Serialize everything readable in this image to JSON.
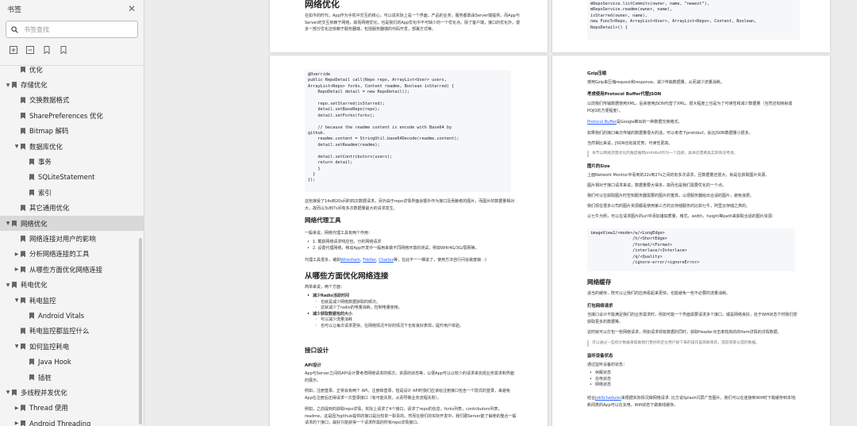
{
  "sidebar": {
    "title": "书签",
    "search_placeholder": "书签查找",
    "toc": [
      {
        "label": "优化",
        "level": 1,
        "toggle": "",
        "selected": false
      },
      {
        "label": "存储优化",
        "level": 0,
        "toggle": "▲",
        "selected": false
      },
      {
        "label": "交换数据格式",
        "level": 1,
        "toggle": "",
        "selected": false
      },
      {
        "label": "SharePreferences 优化",
        "level": 1,
        "toggle": "",
        "selected": false
      },
      {
        "label": "Bitmap 解码",
        "level": 1,
        "toggle": "",
        "selected": false
      },
      {
        "label": "数据库优化",
        "level": 1,
        "toggle": "▲",
        "selected": false
      },
      {
        "label": "事务",
        "level": 2,
        "toggle": "",
        "selected": false
      },
      {
        "label": "SQLiteStatement",
        "level": 2,
        "toggle": "",
        "selected": false
      },
      {
        "label": "索引",
        "level": 2,
        "toggle": "",
        "selected": false
      },
      {
        "label": "其它通用优化",
        "level": 1,
        "toggle": "",
        "selected": false
      },
      {
        "label": "网络优化",
        "level": 0,
        "toggle": "▲",
        "selected": true
      },
      {
        "label": "网络连接对用户的影响",
        "level": 1,
        "toggle": "",
        "selected": false
      },
      {
        "label": "分析网络连接的工具",
        "level": 1,
        "toggle": "▶",
        "selected": false
      },
      {
        "label": "从哪些方面优化网络连接",
        "level": 1,
        "toggle": "▶",
        "selected": false
      },
      {
        "label": "耗电优化",
        "level": 0,
        "toggle": "▲",
        "selected": false
      },
      {
        "label": "耗电监控",
        "level": 1,
        "toggle": "▲",
        "selected": false
      },
      {
        "label": "Android Vitals",
        "level": 2,
        "toggle": "",
        "selected": false
      },
      {
        "label": "耗电监控都监控什么",
        "level": 1,
        "toggle": "",
        "selected": false
      },
      {
        "label": "如何监控耗电",
        "level": 1,
        "toggle": "▲",
        "selected": false
      },
      {
        "label": "Java Hook",
        "level": 2,
        "toggle": "",
        "selected": false
      },
      {
        "label": "插桩",
        "level": 2,
        "toggle": "",
        "selected": false
      },
      {
        "label": "多线程并发优化",
        "level": 0,
        "toggle": "▲",
        "selected": false
      },
      {
        "label": "Thread 使用",
        "level": 1,
        "toggle": "▶",
        "selected": false
      },
      {
        "label": "Android Threading",
        "level": 1,
        "toggle": "▶",
        "selected": false
      }
    ]
  },
  "page1": {
    "title": "网络优化",
    "intro": "在如今的时代，App作为手机中交互的核心，可以说实际上是一个界面，产品的业务，服务都靠由Server端提供。而App与Server的交互依赖于网络，故而网络优化，也是我们的App优化中不可缺少的一个优化点。除了客户端，接口的优化外，很多一部分优化还依赖于服务器端，包括服务器端的代码开发，部署方式等。"
  },
  "page2": {
    "code_top": "mRepoService.listCommits(owner, name, \"newest\"),\nmRepoService.readme(owner, name),\nisStarred(owner, name),\nnew Func5<Repo, ArrayList<User>, ArrayList<Repo>, Content, Boolean,\nRepoDetail>() {"
  },
  "page3": {
    "code": "@Override\npublic RepoDetail call(Repo repo, ArrayList<User> users,\nArrayList<Repo> forks, Content readme, Boolean isStarred) {\n    RepoDetail detail = new RepoDetail();\n\n    repo.setStarred(isStarred);\n    detail.setBaseRepo(repo);\n    detail.setForks(forks);\n\n    // because the readme content is encode with Base64 by\ngithub.\n    readme.content = StringUtil.base64Decode(readme.content);\n    detail.setReadme(readme);\n\n    detail.setContributors(users);\n    return detail;\n    }\n  }\n});",
    "para1": "这些接受了14s到20s间的四次数据请求，另外由于repo详情界面会额外作为接口及贡献者的图片，而图片的数据量相对大，故而以3s到7s间有多次数据量最大的请求发生。",
    "h_tools": "网络代理工具",
    "tools_intro": "一般来说，网络代理工具有两个作用：",
    "tools_items": [
      "1. 截获网络请求响应包，分析网络请求",
      "2. 设置代理网络，移动App开发中一般用来做不同网络环境的测试，例如Wifi/4G/3G/弱网等。"
    ],
    "tools_links_prefix": "代理工具很多，诸如",
    "tools_links": [
      "Wireshark",
      "Fiddler",
      "Charles"
    ],
    "tools_links_suffix": "等，在此不一一细说了，使用方法自行问谷歌度娘. :)",
    "h_aspects": "从哪些方面优化网络连接",
    "aspects_intro": "简单来说，两个方面：",
    "aspects": [
      {
        "head": "减少Radio活跃时间",
        "sub": [
          "也就是减少网络数据获取的频次。",
          "这就减少了radio的电量消耗，控制电量使用。"
        ]
      },
      {
        "head": "减少获取数据包的大小",
        "sub": [
          "可以减少流量消耗",
          "也可以让每次请求更快，在网络情况不好的情况下也有良好表现，提升用户体验。"
        ]
      }
    ],
    "h_api": "接口设计",
    "h_api_sub": "API设计",
    "api_para1": "App与Server之间的API设计要考虑网络请求的频次，资源的状态等，以便App可以以较少的请求来完成业务需求和界面的展示。",
    "api_para2": "例如，注册登录。正常会有两个 API，注册和登录，但是设计 API时我们应该给注册接口包含一个隐式的登录，来避免 App在注册后还得请求一次登录接口（有可能失败，从而导致业务流程失败）。",
    "api_para3": "例如，之前提到的获取repo详情，实际上请求了4个接口，请求了repo的信息，forks列表，contributors列表，readme，这是因为github提供的接口是比较单一职责的。然而在我们的实际开发中，我们跟Server能了解使的整合一般请求的个接口，最好只能获得一个请求所需的所有repo详情接口。"
  },
  "page4": {
    "h_gzip": "Gzip压缩",
    "gzip_para": "使用Gzip来压缩request和response，减少传输数据量，从而减少流量消耗。",
    "h_pb": "考虑使用Protocol Buffer代替JSON",
    "pb_para1": "以前我们传输数据使用XML，后来使用JSON代替了XML，很大程度上也是为了可读性和减少数据量（当然还有映射成POJO的方便程度）。",
    "pb_link": "Protocol Buffer",
    "pb_para2": "是Google推出的一种数据交换格式。",
    "pb_para3": "如果我们的接口每次传输的数据量很大的话，可以考虑下protobuf，会比JSON数据量小很多。",
    "pb_para4": "当然相比来说，JSON也有其优势，可读性更高。",
    "pb_quote": "本节以网络流量优化的角度推荐protobuf作为一个选择，具体还需要具实际情况考虑。",
    "h_img": "图片的Size",
    "img_para1": "上面Network Monitor中看到的22s到27s之间的有多次请求，且数据量还很大，就是在获取图片资源。",
    "img_para2": "图片相对于接口请求来说，数据量要大得多，故而也是我们需要优化的一个点。",
    "img_para3": "我们可以在获取图片时告知服务器需要的图片的宽高，以便服务器给出合适的图片，避免浪费。",
    "img_para4": "我们现在很多公司的图片资源都是使用第三方的云存储服务的比如七牛，阿里云存储之类的。",
    "img_para5": "以七牛为例，可以在请求图片的url中添加诸如质量，格式，width，height等path来获取合适的图片资源：",
    "img_code": "imageView2/<mode>/w/<LongEdge>\n                 /h/<ShortEdge>\n                 /format/<Format>\n                 /interlace/<Interlace>\n                 /q/<Quality>\n                 /ignore-error/<ignoreError>",
    "h_cache": "网络缓存",
    "cache_para": "适当的缓存，既可以让我们的应用看起来更快，也能避免一些不必要的流量消耗。",
    "h_batch": "打包网络请求",
    "batch_para1": "当接口设计不能满足我们的业务需求时，例如可能一个界面需要请求多个接口，或是网络良好，处于Wifi状态下时我们想获取更多的数据等。",
    "batch_para2": "这时就可以打包一些网络请求，例如请求现有数据的同时，获取Header点击率较高的的Item详情的详情数据。",
    "batch_quote": "可以通过一些统计数据来帮助我们更好的定位用户接下来的操作是高概率的，提前获取以提的数据。",
    "h_situation": "监听设备状态",
    "situation_intro": "通过监听设备的状态：",
    "situation_items": [
      "休眠状态",
      "充电状态",
      "网络状态"
    ],
    "js_prefix": "结合",
    "js_link": "JobScheduler",
    "js_suffix": "来根据实际情况做网络请求. 比方说Splash闪屏广告图片，我们可以在连接到Wifi时下载缓存到本地; 新闻类的App可以在充电，Wifi状态下做离线缓存。"
  }
}
